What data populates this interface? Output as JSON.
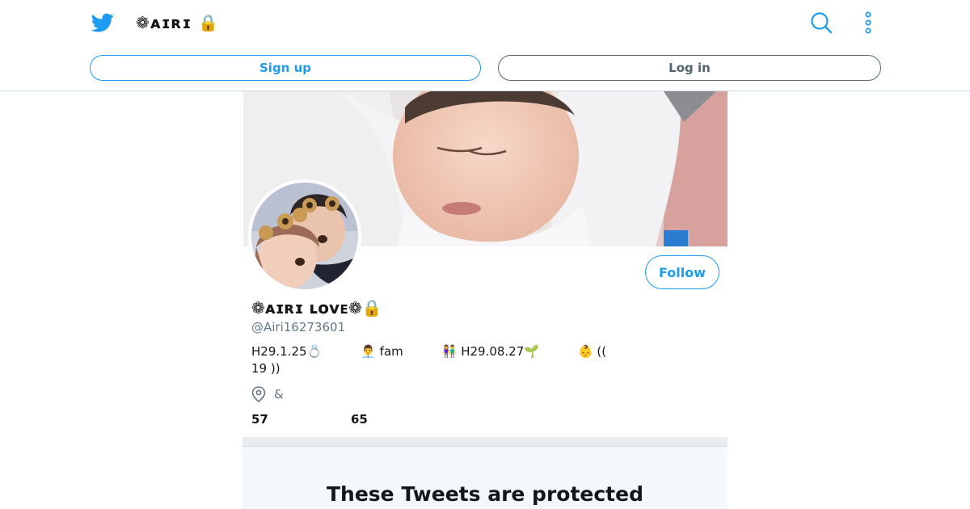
{
  "header": {
    "title": "❁ᴀɪʀɪ 🔒",
    "search_icon": "search-icon",
    "more_icon": "more-vertical-icon"
  },
  "auth": {
    "signup_label": "Sign up",
    "login_label": "Log in"
  },
  "profile": {
    "display_name": "❁ᴀɪʀɪ ʟᴏᴠᴇ❁🔒",
    "handle": "@Airi16273601",
    "follow_label": "Follow",
    "bio_segments": [
      "H29.1.25💍",
      "👨‍💼 fam",
      "👫 H29.08.27🌱",
      "👶 ((",
      "19 ))"
    ],
    "location": "&",
    "following_count": "57",
    "followers_count": "65"
  },
  "protected": {
    "title": "These Tweets are protected"
  },
  "colors": {
    "accent": "#1d9bf0",
    "muted": "#657786",
    "divider": "#e6ecf0"
  }
}
